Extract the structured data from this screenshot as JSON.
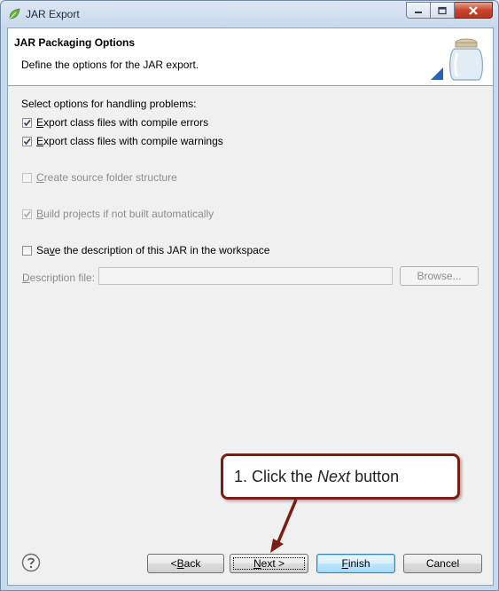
{
  "window": {
    "title": "JAR Export",
    "controls": [
      "minimize-icon",
      "maximize-icon",
      "close-icon"
    ]
  },
  "header": {
    "title": "JAR Packaging Options",
    "description": "Define the options for the JAR export.",
    "icon": "jar-icon"
  },
  "options": {
    "section_label": "Select options for handling problems:",
    "compile_errors": {
      "mnemonic": "E",
      "rest": "xport class files with compile errors",
      "checked": true,
      "enabled": true
    },
    "compile_warnings": {
      "mnemonic": "E",
      "rest": "xport class files with compile warnings",
      "checked": true,
      "enabled": true
    },
    "source_folder": {
      "mnemonic": "C",
      "rest": "reate source folder structure",
      "checked": false,
      "enabled": false
    },
    "build_projects": {
      "mnemonic": "B",
      "rest": "uild projects if not built automatically",
      "checked": true,
      "enabled": false
    },
    "save_description": {
      "pre": "Sa",
      "mnemonic": "v",
      "rest": "e the description of this JAR in the workspace",
      "checked": false,
      "enabled": true
    }
  },
  "description_file": {
    "label_mnemonic": "D",
    "label_rest": "escription file:",
    "value": "",
    "browse_label": "Browse..."
  },
  "footer": {
    "help_icon": "help-icon",
    "back": {
      "pre": "< ",
      "mnemonic": "B",
      "rest": "ack"
    },
    "next": {
      "mnemonic": "N",
      "rest": "ext >"
    },
    "finish": {
      "mnemonic": "F",
      "rest": "inish"
    },
    "cancel_label": "Cancel"
  },
  "callout": {
    "pre": "1. Click the ",
    "emphasis": "Next",
    "post": " button"
  },
  "colors": {
    "callout_border": "#7a1d13",
    "close_button": "#c7442b",
    "focus_border": "#3c7fb1"
  }
}
